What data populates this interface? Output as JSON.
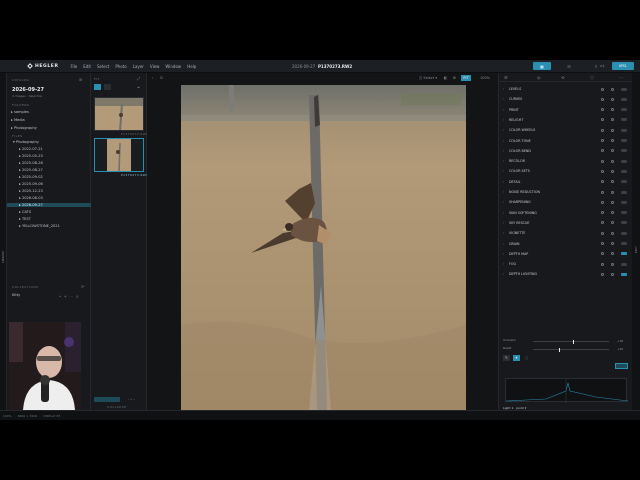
{
  "app": {
    "name": "HEGLER",
    "menu": [
      "File",
      "Edit",
      "Select",
      "Photo",
      "Layer",
      "View",
      "Window",
      "Help"
    ]
  },
  "file": {
    "date": "2026-09-27",
    "name": "P1370273.RW2"
  },
  "modes": [
    "Library",
    "Develop",
    "Export"
  ],
  "version": "v1.",
  "update_label": "UPD.",
  "vertical_labels": {
    "left": "LIBRARY",
    "right": "EDIT"
  },
  "catalog": {
    "section": "CATALOG",
    "title": "2026-09-27",
    "subtitle": "4 images · Selection",
    "folders_label": "FOLDERS",
    "folders": [
      "samples",
      "Media",
      "Photography"
    ],
    "files_label": "FILES",
    "root": "Photography",
    "items": [
      "2022-07-21",
      "2025-05-23",
      "2025-08-26",
      "2025-08-27",
      "2025-09-02",
      "2025-09-06",
      "2025-12-23",
      "2026-08-03",
      "2026-09-27",
      "CATS",
      "TEST",
      "YELLOWSTONE_2021"
    ],
    "selected": "2026-09-27",
    "collections_label": "COLLECTIONS",
    "collections": [
      "Kitty"
    ]
  },
  "filmstrip": {
    "label": "FIT",
    "thumbs": [
      {
        "name": "P1370272.RW2"
      },
      {
        "name": "P1370273.RW2"
      }
    ],
    "collapse_label": "COLLAPSE"
  },
  "viewer": {
    "compare_label": "Select",
    "zoom": "100%"
  },
  "tools": [
    {
      "name": "LEVELS"
    },
    {
      "name": "CURVES"
    },
    {
      "name": "PRINT"
    },
    {
      "name": "RELIGHT"
    },
    {
      "name": "COLOR WHEELS"
    },
    {
      "name": "COLOR TONE"
    },
    {
      "name": "COLOR BEND"
    },
    {
      "name": "RECOLOR"
    },
    {
      "name": "COLOR SETS"
    },
    {
      "name": "DETAIL"
    },
    {
      "name": "NOISE REDUCTION"
    },
    {
      "name": "SHARPENING"
    },
    {
      "name": "SKIN SOFTENING"
    },
    {
      "name": "SKY RESCUE"
    },
    {
      "name": "VIGNETTE"
    },
    {
      "name": "GRAIN"
    },
    {
      "name": "DEPTH MAP"
    },
    {
      "name": "FOG"
    },
    {
      "name": "DEPTH LIGHTING"
    }
  ],
  "depth_lighting": {
    "ambient_label": "Ambient",
    "ambient_value": "+36",
    "relief_label": "Relief",
    "relief_value": "+20",
    "light_label": "Light 1 · point",
    "strength_label": "Strength",
    "strength_value": "80",
    "depth_label": "Depth",
    "depth_value": "80",
    "reach_label": "Reach",
    "reach_value": "36",
    "focus_label": "Focus spacing",
    "flash_label": "Flash"
  },
  "status": {
    "zoom": "100%",
    "dims": "4800 × 3200",
    "profile": "DISPLAY P3"
  }
}
